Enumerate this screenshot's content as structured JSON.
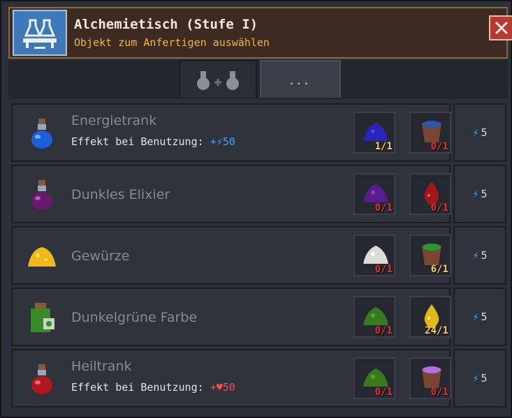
{
  "header": {
    "title": "Alchemietisch (Stufe I)",
    "subtitle": "Objekt zum Anfertigen auswählen",
    "icon": "alchemy-table-icon",
    "close_icon": "close-icon"
  },
  "tabs": [
    {
      "name": "craft",
      "icon": "potion-craft-icon",
      "active": false
    },
    {
      "name": "more",
      "label": "...",
      "active": true
    }
  ],
  "rows": [
    {
      "name": "Energietrank",
      "effect_label": "Effekt bei Benutzung:",
      "effect_value": "+⚡50",
      "effect_color": "#3ea6ff",
      "icon": "blue-potion-icon",
      "ingredients": [
        {
          "icon": "blue-dust-icon",
          "qty": "1/1",
          "ok": true
        },
        {
          "icon": "water-pot-icon",
          "qty": "0/1",
          "ok": false
        }
      ],
      "cost": "5"
    },
    {
      "name": "Dunkles Elixier",
      "icon": "purple-potion-icon",
      "ingredients": [
        {
          "icon": "purple-dust-icon",
          "qty": "0/1",
          "ok": false
        },
        {
          "icon": "blood-drop-icon",
          "qty": "0/1",
          "ok": false
        }
      ],
      "cost": "5"
    },
    {
      "name": "Gewürze",
      "icon": "spice-pile-icon",
      "ingredients": [
        {
          "icon": "white-powder-icon",
          "qty": "0/1",
          "ok": false
        },
        {
          "icon": "green-pot-icon",
          "qty": "6/1",
          "ok": true
        }
      ],
      "cost": "5"
    },
    {
      "name": "Dunkelgrüne Farbe",
      "icon": "green-dye-jar-icon",
      "ingredients": [
        {
          "icon": "green-dust-icon",
          "qty": "0/1",
          "ok": false
        },
        {
          "icon": "golden-drop-icon",
          "qty": "24/1",
          "ok": true
        }
      ],
      "cost": "5"
    },
    {
      "name": "Heiltrank",
      "effect_label": "Effekt bei Benutzung:",
      "effect_value": "+♥50",
      "effect_color": "#ff4a4a",
      "icon": "red-potion-icon",
      "ingredients": [
        {
          "icon": "green-dust-icon",
          "qty": "0/1",
          "ok": false
        },
        {
          "icon": "pink-pot-icon",
          "qty": "0/1",
          "ok": false
        }
      ],
      "cost": "5"
    }
  ],
  "colors": {
    "header_bg": "#3d2a20",
    "title": "#f2ead8",
    "subtitle": "#f0b640",
    "qty_ok": "#ffd24a",
    "qty_bad": "#e03030",
    "energy": "#3ea6ff"
  }
}
